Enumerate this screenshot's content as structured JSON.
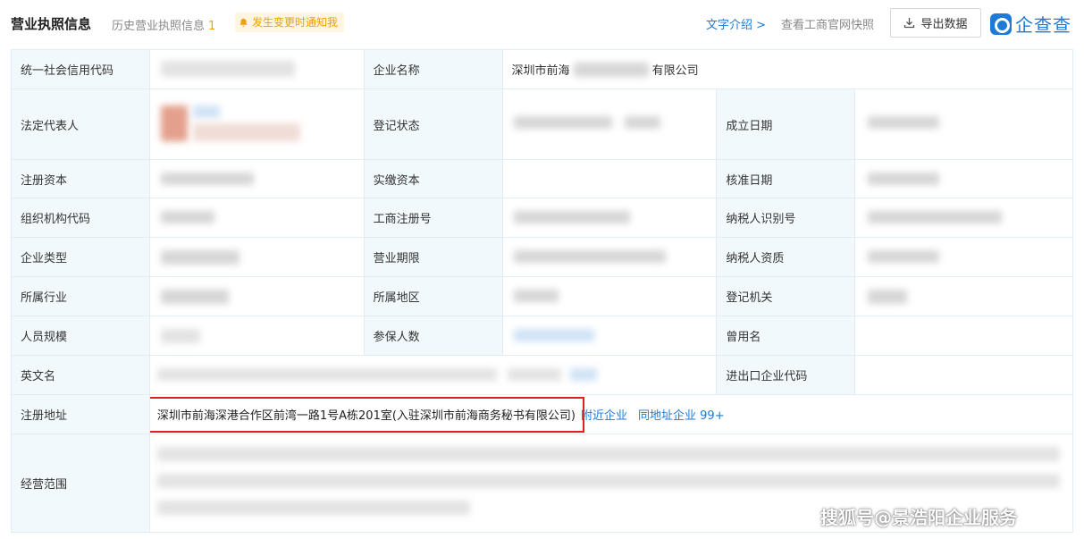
{
  "header": {
    "title": "营业执照信息",
    "history_label": "历史营业执照信息",
    "history_count": "1",
    "notify_label": "发生变更时通知我",
    "text_intro": "文字介绍 >",
    "snapshot": "查看工商官网快照",
    "export_label": "导出数据",
    "logo_text": "企查查"
  },
  "labels": {
    "credit_code": "统一社会信用代码",
    "company_name": "企业名称",
    "legal_rep": "法定代表人",
    "reg_status": "登记状态",
    "founded": "成立日期",
    "reg_capital": "注册资本",
    "paid_capital": "实缴资本",
    "approval_date": "核准日期",
    "org_code": "组织机构代码",
    "biz_reg_no": "工商注册号",
    "taxpayer_id": "纳税人识别号",
    "company_type": "企业类型",
    "biz_term": "营业期限",
    "taxpayer_qual": "纳税人资质",
    "industry": "所属行业",
    "region": "所属地区",
    "reg_authority": "登记机关",
    "staff_size": "人员规模",
    "insured": "参保人数",
    "former_name": "曾用名",
    "english_name": "英文名",
    "import_export": "进出口企业代码",
    "reg_address": "注册地址",
    "biz_scope": "经营范围"
  },
  "values": {
    "company_name_prefix": "深圳市前海",
    "company_name_suffix": "有限公司",
    "reg_address": "深圳市前海深港合作区前湾一路1号A栋201室(入驻深圳市前海商务秘书有限公司)",
    "nearby_link": "附近企业",
    "same_address_link": "同地址企业 99+"
  },
  "watermark": "搜狐号@景浩阳企业服务",
  "colors": {
    "accent": "#1f7ad6",
    "label_bg": "#f2f9fc",
    "highlight_border": "#e02020",
    "notify_bg": "#fff5e0",
    "notify_text": "#f0a000"
  }
}
